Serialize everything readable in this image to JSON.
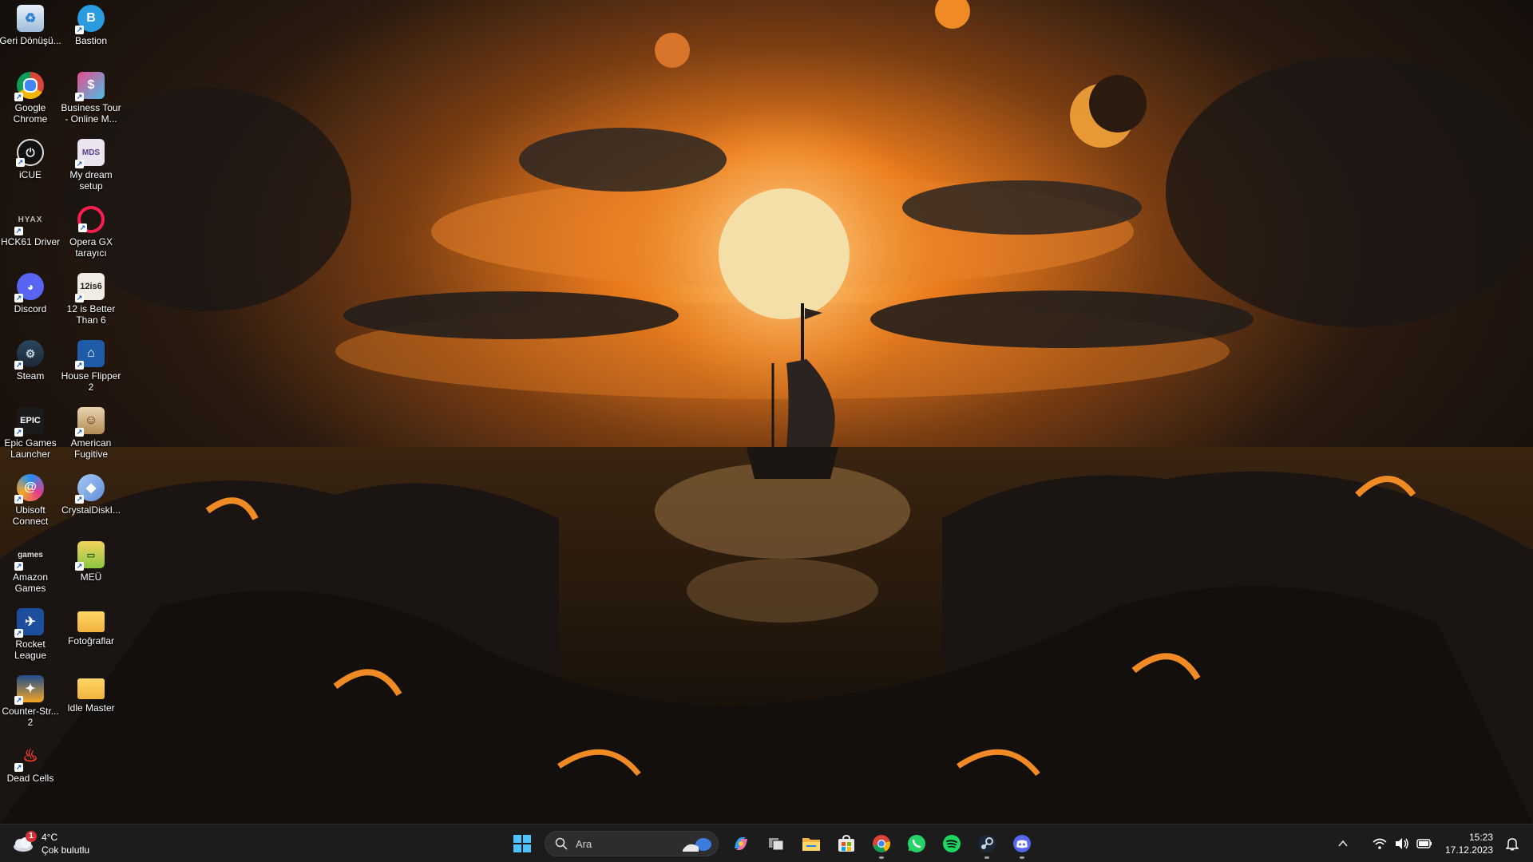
{
  "desktop": {
    "icons": [
      {
        "label": "Geri Dönüşü...",
        "icon": "recycle-bin-icon"
      },
      {
        "label": "Bastion",
        "icon": "bastion-icon"
      },
      {
        "label": "Google Chrome",
        "icon": "chrome-icon"
      },
      {
        "label": "Business Tour - Online M...",
        "icon": "business-tour-icon"
      },
      {
        "label": "iCUE",
        "icon": "icue-icon"
      },
      {
        "label": "My dream setup",
        "icon": "my-dream-setup-icon"
      },
      {
        "label": "HCK61 Driver",
        "icon": "hck61-driver-icon"
      },
      {
        "label": "Opera GX tarayıcı",
        "icon": "opera-gx-icon"
      },
      {
        "label": "Discord",
        "icon": "discord-icon"
      },
      {
        "label": "12 is Better Than 6",
        "icon": "12-is-better-than-6-icon"
      },
      {
        "label": "Steam",
        "icon": "steam-icon"
      },
      {
        "label": "House Flipper 2",
        "icon": "house-flipper-2-icon"
      },
      {
        "label": "Epic Games Launcher",
        "icon": "epic-games-icon"
      },
      {
        "label": "American Fugitive",
        "icon": "american-fugitive-icon"
      },
      {
        "label": "Ubisoft Connect",
        "icon": "ubisoft-connect-icon"
      },
      {
        "label": "CrystalDiskI...",
        "icon": "crystaldisk-icon"
      },
      {
        "label": "Amazon Games",
        "icon": "amazon-games-icon"
      },
      {
        "label": "MEÜ",
        "icon": "meu-icon"
      },
      {
        "label": "Rocket League",
        "icon": "rocket-league-icon"
      },
      {
        "label": "Fotoğraflar",
        "icon": "folder-icon"
      },
      {
        "label": "Counter-Str... 2",
        "icon": "counter-strike-2-icon"
      },
      {
        "label": "Idle Master",
        "icon": "folder-icon"
      },
      {
        "label": "Dead Cells",
        "icon": "dead-cells-icon"
      }
    ]
  },
  "taskbar": {
    "weather": {
      "temp": "4°C",
      "condition": "Çok bulutlu",
      "badge": "1",
      "icon": "weather-cloud-icon"
    },
    "search": {
      "placeholder": "Ara",
      "icon": "search-icon"
    },
    "apps": [
      {
        "name": "start",
        "icon": "windows-start-icon"
      },
      {
        "name": "copilot",
        "icon": "copilot-icon"
      },
      {
        "name": "task-view",
        "icon": "task-view-icon"
      },
      {
        "name": "file-explorer",
        "icon": "folder-icon"
      },
      {
        "name": "microsoft-store",
        "icon": "store-icon"
      },
      {
        "name": "chrome",
        "icon": "chrome-icon"
      },
      {
        "name": "whatsapp",
        "icon": "whatsapp-icon"
      },
      {
        "name": "spotify",
        "icon": "spotify-icon"
      },
      {
        "name": "steam",
        "icon": "steam-icon"
      },
      {
        "name": "discord",
        "icon": "discord-icon"
      }
    ],
    "tray": {
      "icons": [
        "chevron-up-icon",
        "wifi-icon",
        "volume-icon",
        "battery-icon"
      ],
      "time": "15:23",
      "date": "17.12.2023",
      "notification_icon": "bell-icon"
    }
  },
  "colors": {
    "taskbar_bg": "#1c1c1c",
    "accent_orange": "#f08a24",
    "sun": "#f5dfa8"
  }
}
